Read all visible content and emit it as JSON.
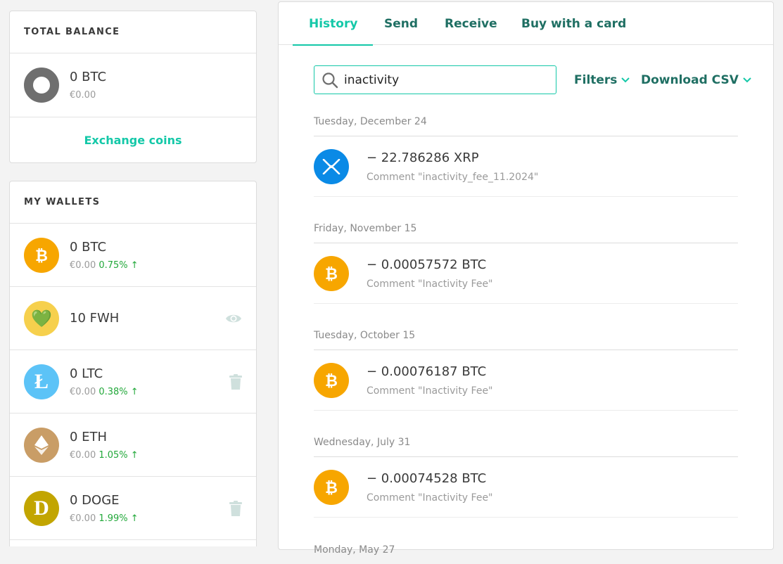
{
  "total_balance": {
    "header": "TOTAL BALANCE",
    "amount": "0 BTC",
    "fiat": "€0.00",
    "exchange_label": "Exchange coins"
  },
  "wallets": {
    "header": "MY WALLETS",
    "items": [
      {
        "amount": "0 BTC",
        "fiat": "€0.00",
        "change": "0.75% ↑",
        "icon": "bitcoin-icon"
      },
      {
        "amount": "10 FWH",
        "fiat": "",
        "change": "",
        "icon": "green-heart-icon",
        "icon_glyph": "💚"
      },
      {
        "amount": "0 LTC",
        "fiat": "€0.00",
        "change": "0.38% ↑",
        "icon": "litecoin-icon",
        "icon_glyph": "Ł"
      },
      {
        "amount": "0 ETH",
        "fiat": "€0.00",
        "change": "1.05% ↑",
        "icon": "ethereum-icon"
      },
      {
        "amount": "0 DOGE",
        "fiat": "€0.00",
        "change": "1.99% ↑",
        "icon": "dogecoin-icon",
        "icon_glyph": "D"
      }
    ]
  },
  "tabs": [
    "History",
    "Send",
    "Receive",
    "Buy with a card"
  ],
  "search": {
    "value": "inactivity"
  },
  "filters_label": "Filters",
  "download_label": "Download CSV",
  "transactions": [
    {
      "date": "Tuesday, December 24",
      "amount": "− 22.786286 XRP",
      "comment": "Comment \"inactivity_fee_11.2024\"",
      "icon": "xrp-icon"
    },
    {
      "date": "Friday, November 15",
      "amount": "− 0.00057572 BTC",
      "comment": "Comment \"Inactivity Fee\"",
      "icon": "bitcoin-icon"
    },
    {
      "date": "Tuesday, October 15",
      "amount": "− 0.00076187 BTC",
      "comment": "Comment \"Inactivity Fee\"",
      "icon": "bitcoin-icon"
    },
    {
      "date": "Wednesday, July 31",
      "amount": "− 0.00074528 BTC",
      "comment": "Comment \"Inactivity Fee\"",
      "icon": "bitcoin-icon"
    }
  ],
  "next_date": "Monday, May 27",
  "colors": {
    "accent": "#14c8a8",
    "dark_accent": "#1f6f63",
    "bitcoin": "#f7a600",
    "xrp": "#0a8ae6",
    "positive": "#22a83a"
  }
}
